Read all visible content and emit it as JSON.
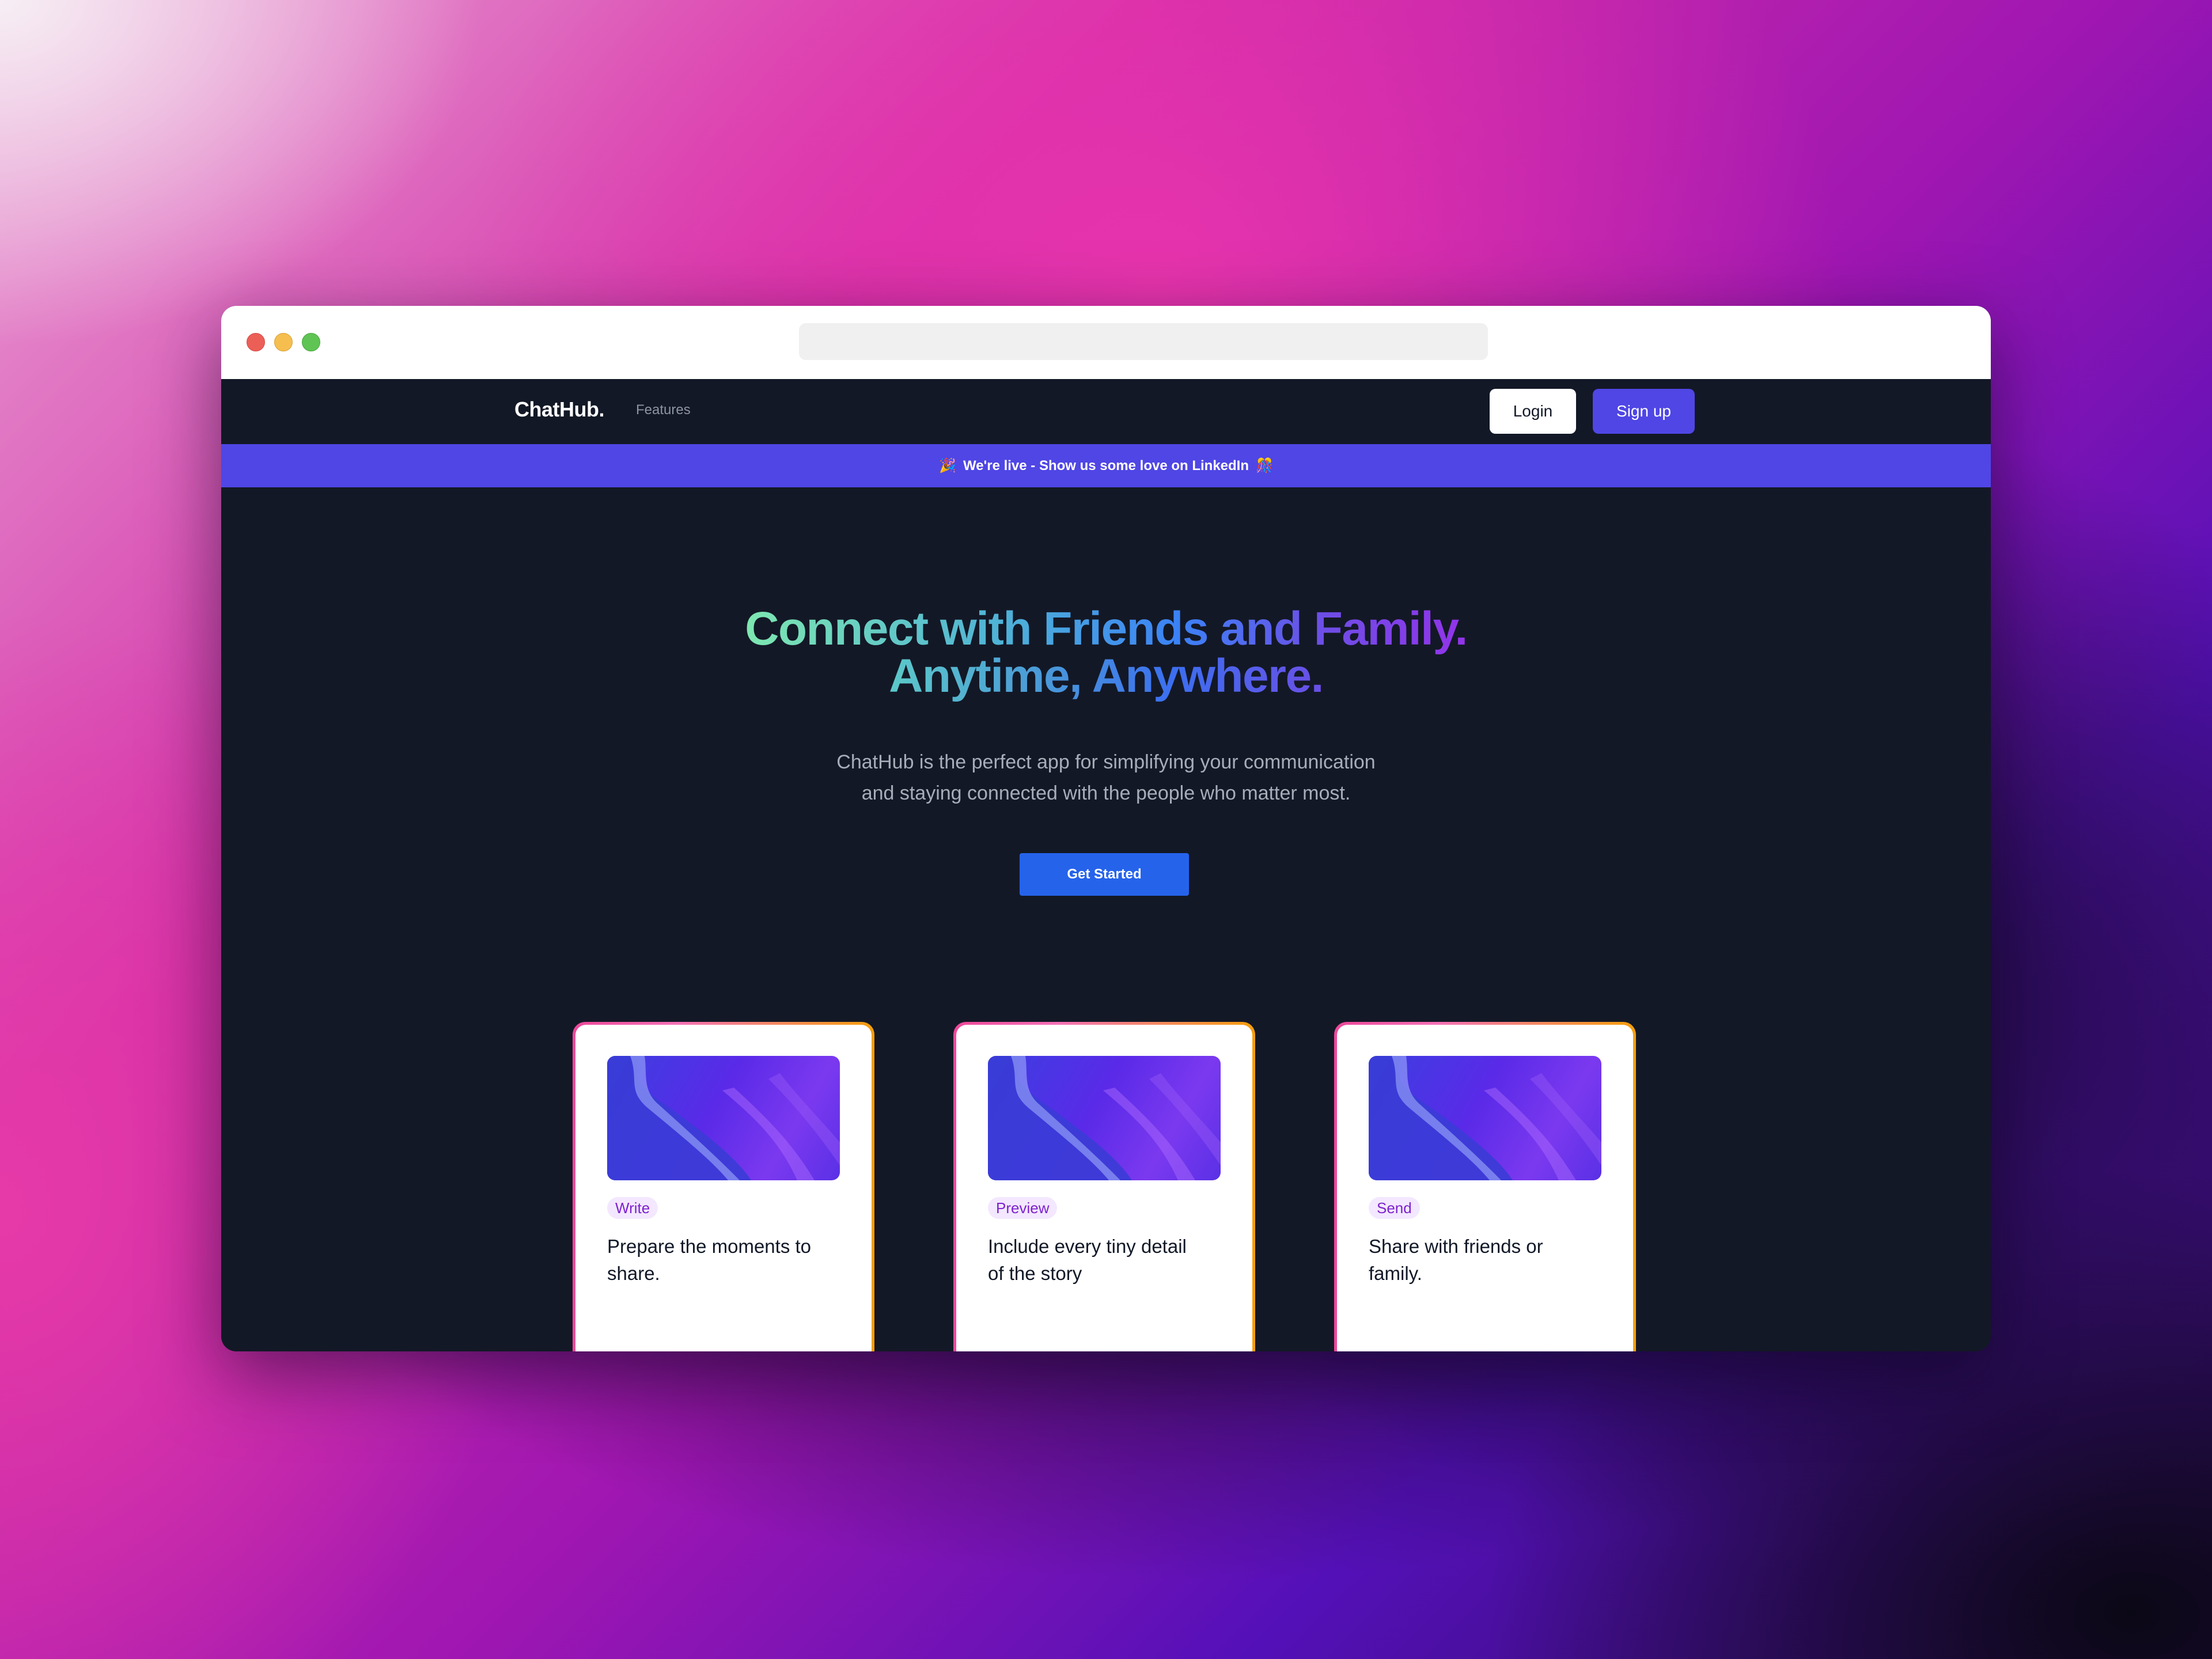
{
  "browser": {
    "address_bar_value": ""
  },
  "navbar": {
    "logo": "ChatHub.",
    "links": [
      "Features"
    ],
    "login_label": "Login",
    "signup_label": "Sign up"
  },
  "banner": {
    "leading_icon": "🎉",
    "text": "We're live - Show us some love on LinkedIn",
    "trailing_icon": "🎊"
  },
  "hero": {
    "title_line1": "Connect with Friends and Family.",
    "title_line2": "Anytime, Anywhere.",
    "subtitle_line1": "ChatHub is the perfect app for simplifying your communication",
    "subtitle_line2": "and staying connected with the people who matter most.",
    "cta_label": "Get Started"
  },
  "cards": [
    {
      "tag": "Write",
      "text": "Prepare the moments to share."
    },
    {
      "tag": "Preview",
      "text": "Include every tiny detail of the story"
    },
    {
      "tag": "Send",
      "text": "Share with friends or family."
    }
  ],
  "colors": {
    "accent": "#4f46e5",
    "cta": "#2563eb",
    "page_background": "#131826",
    "tag_background": "#f3e8ff",
    "tag_text": "#7e22ce"
  }
}
